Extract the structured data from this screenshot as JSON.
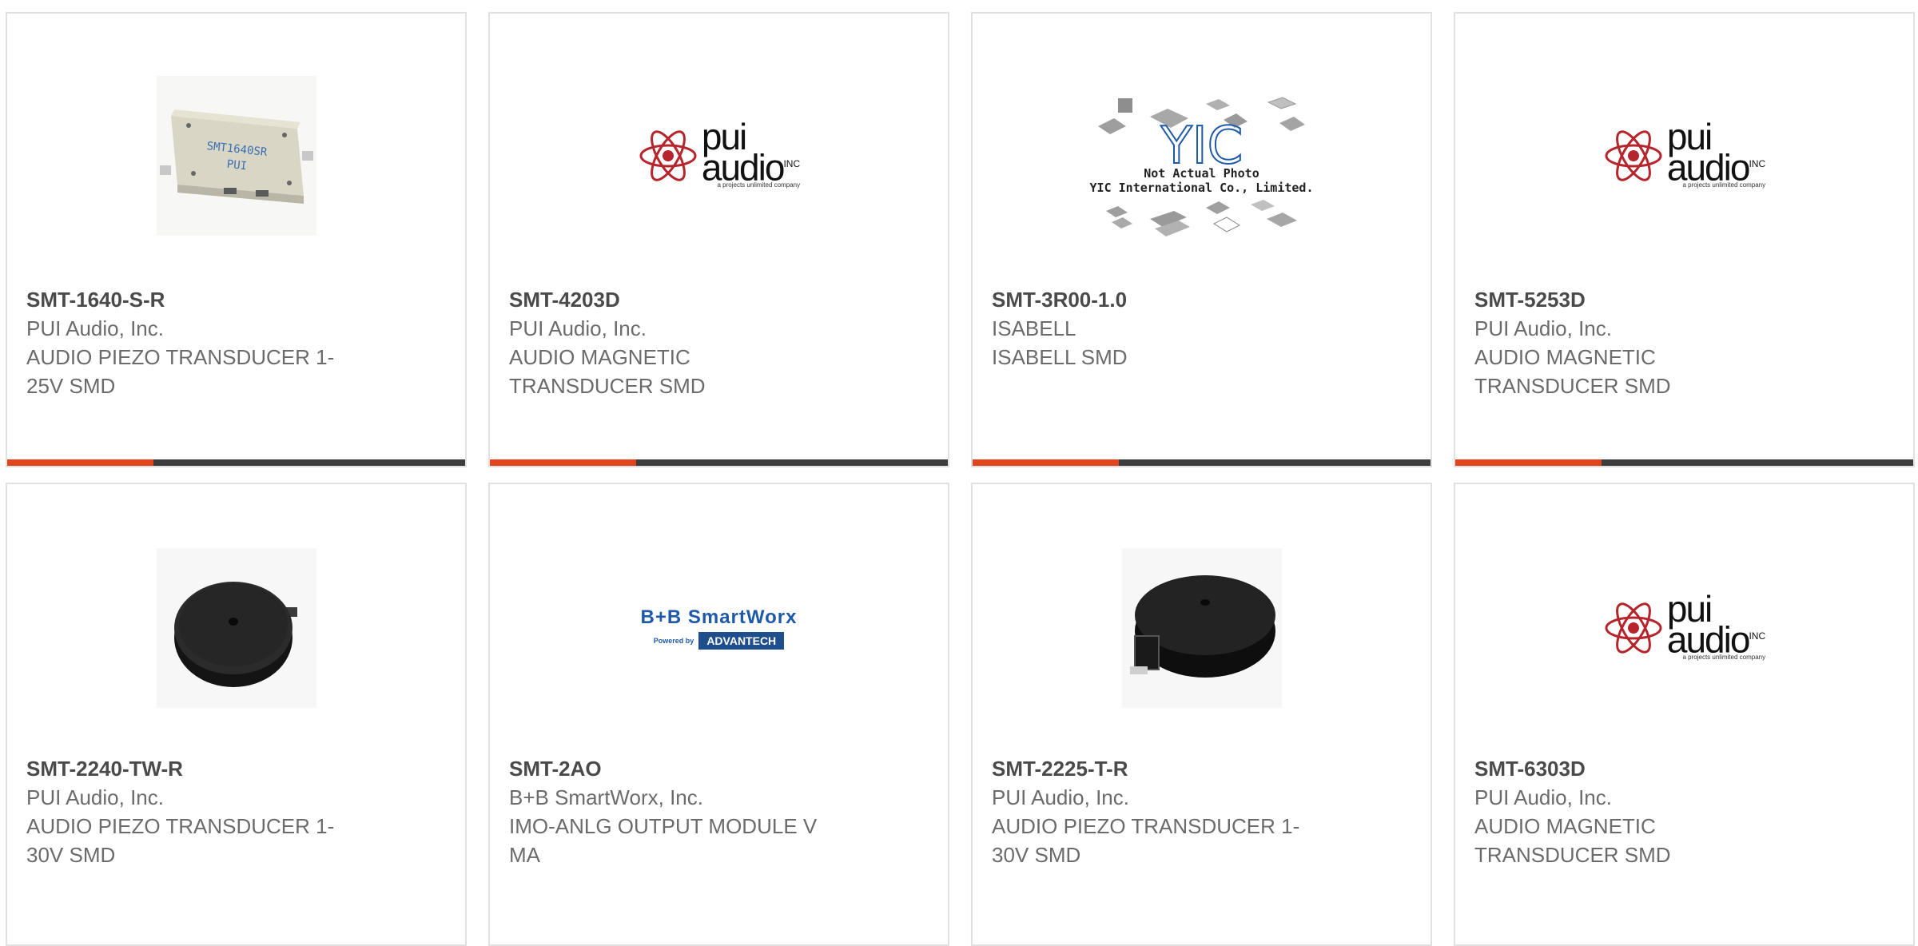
{
  "products": [
    {
      "part": "SMT-1640-S-R",
      "mfr": "PUI Audio, Inc.",
      "desc_l1": "AUDIO PIEZO TRANSDUCER 1-",
      "desc_l2": "25V SMD",
      "image": "smd-square-buzzer"
    },
    {
      "part": "SMT-4203D",
      "mfr": "PUI Audio, Inc.",
      "desc_l1": "AUDIO MAGNETIC",
      "desc_l2": "TRANSDUCER SMD",
      "image": "pui-audio-logo"
    },
    {
      "part": "SMT-3R00-1.0",
      "mfr": "ISABELL",
      "desc_l1": "ISABELL SMD",
      "desc_l2": "",
      "image": "yic-not-actual-photo"
    },
    {
      "part": "SMT-5253D",
      "mfr": "PUI Audio, Inc.",
      "desc_l1": "AUDIO MAGNETIC",
      "desc_l2": "TRANSDUCER SMD",
      "image": "pui-audio-logo"
    },
    {
      "part": "SMT-2240-TW-R",
      "mfr": "PUI Audio, Inc.",
      "desc_l1": "AUDIO PIEZO TRANSDUCER 1-",
      "desc_l2": "30V SMD",
      "image": "round-buzzer"
    },
    {
      "part": "SMT-2AO",
      "mfr": "B+B SmartWorx, Inc.",
      "desc_l1": "IMO-ANLG OUTPUT MODULE V",
      "desc_l2": "MA",
      "image": "bb-smartworx-logo"
    },
    {
      "part": "SMT-2225-T-R",
      "mfr": "PUI Audio, Inc.",
      "desc_l1": "AUDIO PIEZO TRANSDUCER 1-",
      "desc_l2": "30V SMD",
      "image": "round-buzzer-tab"
    },
    {
      "part": "SMT-6303D",
      "mfr": "PUI Audio, Inc.",
      "desc_l1": "AUDIO MAGNETIC",
      "desc_l2": "TRANSDUCER SMD",
      "image": "pui-audio-logo"
    }
  ],
  "logos": {
    "pui_word_1": "pui",
    "pui_word_2": "audio",
    "pui_inc": "INC",
    "pui_tagline": "a projects unlimited company",
    "bb_top": "B+B SmartWorx",
    "bb_powered": "Powered by",
    "bb_advantech": "ADVANTECH",
    "yic_mark": "YIC",
    "yic_line1": "Not Actual Photo",
    "yic_line2": "YIC International Co., Limited.",
    "smd_print_1": "SMT1640SR",
    "smd_print_2": "PUI"
  },
  "colors": {
    "accent": "#e2451d",
    "bar": "#3d3d3d",
    "border": "#e1e1e1",
    "pui_red": "#b5252b"
  }
}
